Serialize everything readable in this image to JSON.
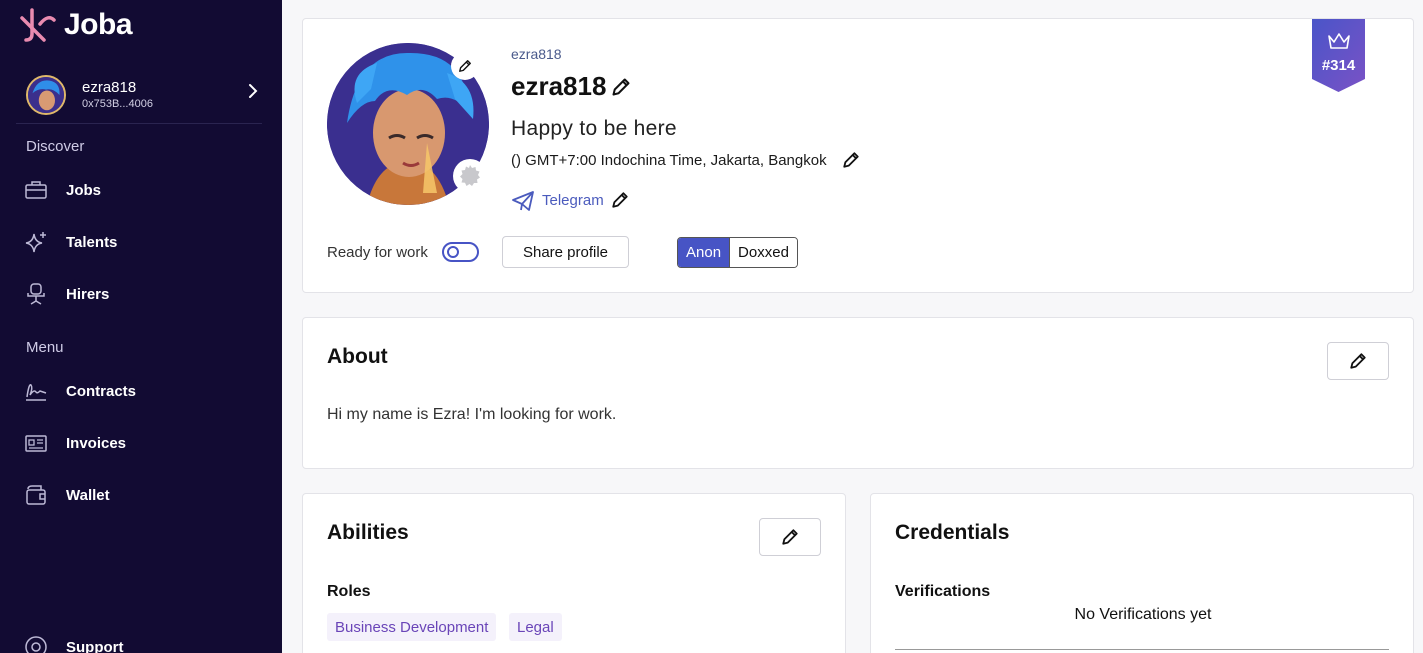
{
  "app": {
    "name": "Joba"
  },
  "user": {
    "name": "ezra818",
    "address": "0x753B...4006"
  },
  "sidebar": {
    "discover_label": "Discover",
    "discover_items": [
      {
        "label": "Jobs",
        "icon": "briefcase-icon"
      },
      {
        "label": "Talents",
        "icon": "sparkle-icon"
      },
      {
        "label": "Hirers",
        "icon": "chair-icon"
      }
    ],
    "menu_label": "Menu",
    "menu_items": [
      {
        "label": "Contracts",
        "icon": "signature-icon"
      },
      {
        "label": "Invoices",
        "icon": "invoice-icon"
      },
      {
        "label": "Wallet",
        "icon": "wallet-icon"
      }
    ],
    "support_label": "Support"
  },
  "profile": {
    "handle": "ezra818",
    "display_name": "ezra818",
    "tagline": "Happy to be here",
    "timezone": "() GMT+7:00 Indochina Time, Jakarta, Bangkok",
    "telegram_label": "Telegram",
    "ready_label": "Ready for work",
    "ready_for_work": false,
    "share_label": "Share profile",
    "mode_options": [
      "Anon",
      "Doxxed"
    ],
    "mode_selected": "Anon",
    "rank": "#314"
  },
  "about": {
    "title": "About",
    "text": "Hi my name is Ezra! I'm looking for work."
  },
  "abilities": {
    "title": "Abilities",
    "roles_label": "Roles",
    "roles": [
      "Business Development",
      "Legal"
    ]
  },
  "credentials": {
    "title": "Credentials",
    "verifications_label": "Verifications",
    "empty_text": "No Verifications yet"
  },
  "colors": {
    "sidebar_bg": "#120b33",
    "accent": "#4754c5",
    "ribbon": "#5b4fc4",
    "chip_text": "#6a45b8"
  }
}
